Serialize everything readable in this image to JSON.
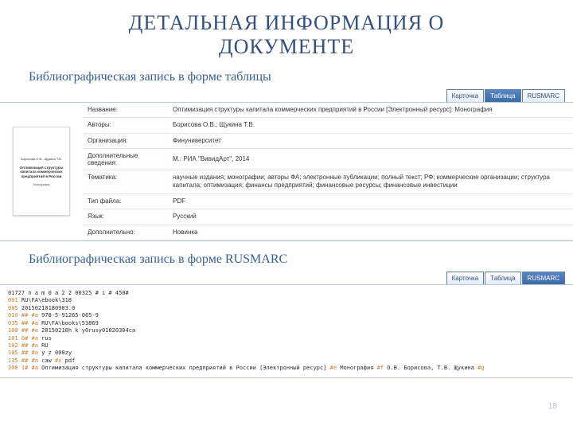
{
  "title_line1": "ДЕТАЛЬНАЯ  ИНФОРМАЦИЯ  О",
  "title_line2": "ДОКУМЕНТЕ",
  "subhead_table": "Библиографическая запись в форме таблицы",
  "subhead_rusmarc": "Библиографическая запись в форме RUSMARC",
  "page_number": "18",
  "tabs": {
    "card": "Карточка",
    "table": "Таблица",
    "rusmarc": "RUSMARC"
  },
  "thumb": {
    "authors": "Борисова О.В., Щукина Т.В.",
    "title": "Оптимизация структуры\nкапитала коммерческих\nпредприятий в России",
    "type": "Монография"
  },
  "meta": {
    "k_name": "Название:",
    "v_name": "Оптимизация структуры капитала коммерческих предприятий в России [Электронный ресурс]: Монография",
    "k_auth": "Авторы:",
    "v_auth": "Борисова О.В.; Щукина Т.В.",
    "k_org": "Организация:",
    "v_org": "Финуниверситет",
    "k_more": "Дополнительные сведения:",
    "v_more": "М.: РИА \"ВивидАрт\", 2014",
    "k_theme": "Тематика:",
    "v_theme": "научные издания; монографии; авторы ФА; электронные публикации; полный текст; РФ; коммерческие организации; структура капитала; оптимизация; финансы предприятий; финансовые ресурсы; финансовые инвестиции",
    "k_type": "Тип файла:",
    "v_type": "PDF",
    "k_lang": "Язык:",
    "v_lang": "Русский",
    "k_add": "Дополнительно:",
    "v_add": "Новинка"
  },
  "rusmarc": {
    "l01": "01727 n a m 0 a 2 2 00325 # i # 450#",
    "l02": {
      "tag": "001 ",
      "rest": "RU\\FA\\ebook\\318"
    },
    "l03": {
      "tag": "005 ",
      "rest": "20150210180903.0"
    },
    "l04": {
      "tag": "010 ## ",
      "sub": "#a",
      "rest": " 978-5-91265-065-9"
    },
    "l05": {
      "tag": "035 ## ",
      "sub": "#a",
      "rest": " RU\\FA\\books\\53869"
    },
    "l06": {
      "tag": "100 ## ",
      "sub": "#a",
      "rest": " 20150210h k y0rusy01020304ca"
    },
    "l07": {
      "tag": "101 0# ",
      "sub": "#a",
      "rest": " rus"
    },
    "l08": {
      "tag": "102 ## ",
      "sub": "#a",
      "rest": " RU"
    },
    "l09": {
      "tag": "105 ## ",
      "sub": "#a",
      "rest": " y z 000zy"
    },
    "l10": {
      "tag": "135 ## ",
      "sub1": "#a",
      "rest1": " caw ",
      "sub2": "#x",
      "rest2": " pdf"
    },
    "l11": {
      "tag": "200 1# ",
      "sub1": "#a",
      "rest1": " Оптимизация структуры капитала коммерческих предприятий в России [Электронный ресурс] ",
      "sub2": "#e",
      "rest2": " Монография ",
      "sub3": "#f",
      "rest3": " О.В. Борисова, Т.В. Щукина ",
      "sub4": "#g"
    }
  }
}
